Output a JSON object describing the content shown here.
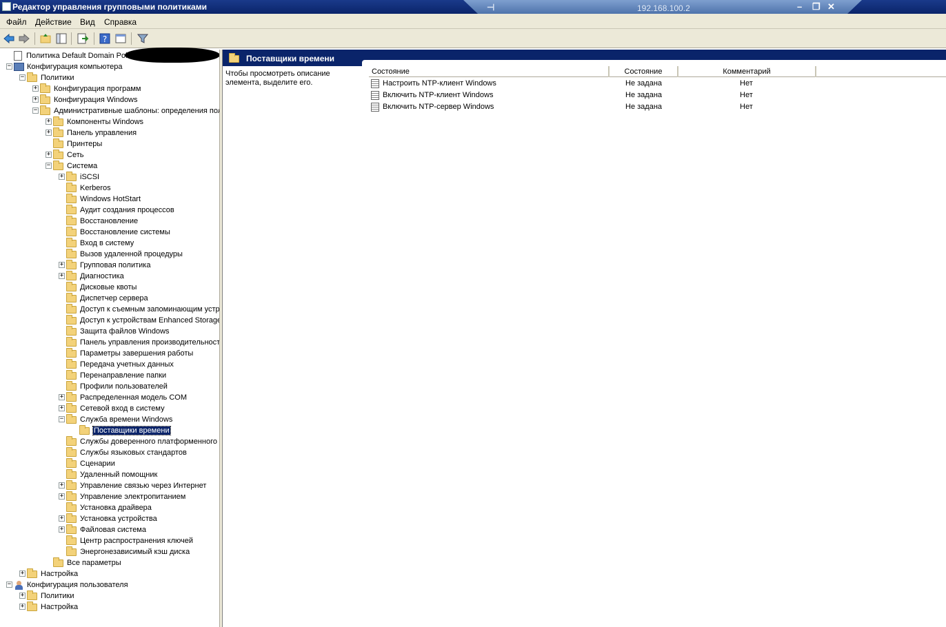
{
  "window": {
    "title": "Редактор управления групповыми политиками"
  },
  "rdp": {
    "ip": "192.168.100.2"
  },
  "menu": [
    "Файл",
    "Действие",
    "Вид",
    "Справка"
  ],
  "tree": [
    {
      "label": "Политика Default Domain Policy [",
      "icon": "document-icon",
      "depth": 0,
      "expander": "none"
    },
    {
      "label": "Конфигурация компьютера",
      "icon": "computer-icon",
      "depth": 0,
      "expander": "minus"
    },
    {
      "label": "Политики",
      "icon": "folder-icon",
      "depth": 1,
      "expander": "minus"
    },
    {
      "label": "Конфигурация программ",
      "icon": "folder-icon",
      "depth": 2,
      "expander": "plus"
    },
    {
      "label": "Конфигурация Windows",
      "icon": "folder-icon",
      "depth": 2,
      "expander": "plus"
    },
    {
      "label": "Административные шаблоны: определения политик",
      "icon": "folder-icon",
      "depth": 2,
      "expander": "minus"
    },
    {
      "label": "Компоненты Windows",
      "icon": "folder-icon",
      "depth": 3,
      "expander": "plus"
    },
    {
      "label": "Панель управления",
      "icon": "folder-icon",
      "depth": 3,
      "expander": "plus"
    },
    {
      "label": "Принтеры",
      "icon": "folder-icon",
      "depth": 3,
      "expander": "none"
    },
    {
      "label": "Сеть",
      "icon": "folder-icon",
      "depth": 3,
      "expander": "plus"
    },
    {
      "label": "Система",
      "icon": "folder-icon",
      "depth": 3,
      "expander": "minus"
    },
    {
      "label": "iSCSI",
      "icon": "folder-icon",
      "depth": 4,
      "expander": "plus"
    },
    {
      "label": "Kerberos",
      "icon": "folder-icon",
      "depth": 4,
      "expander": "none"
    },
    {
      "label": "Windows HotStart",
      "icon": "folder-icon",
      "depth": 4,
      "expander": "none"
    },
    {
      "label": "Аудит создания процессов",
      "icon": "folder-icon",
      "depth": 4,
      "expander": "none"
    },
    {
      "label": "Восстановление",
      "icon": "folder-icon",
      "depth": 4,
      "expander": "none"
    },
    {
      "label": "Восстановление системы",
      "icon": "folder-icon",
      "depth": 4,
      "expander": "none"
    },
    {
      "label": "Вход в систему",
      "icon": "folder-icon",
      "depth": 4,
      "expander": "none"
    },
    {
      "label": "Вызов удаленной процедуры",
      "icon": "folder-icon",
      "depth": 4,
      "expander": "none"
    },
    {
      "label": "Групповая политика",
      "icon": "folder-icon",
      "depth": 4,
      "expander": "plus"
    },
    {
      "label": "Диагностика",
      "icon": "folder-icon",
      "depth": 4,
      "expander": "plus"
    },
    {
      "label": "Дисковые квоты",
      "icon": "folder-icon",
      "depth": 4,
      "expander": "none"
    },
    {
      "label": "Диспетчер сервера",
      "icon": "folder-icon",
      "depth": 4,
      "expander": "none"
    },
    {
      "label": "Доступ к съемным запоминающим устройствам",
      "icon": "folder-icon",
      "depth": 4,
      "expander": "none"
    },
    {
      "label": "Доступ к устройствам Enhanced Storage",
      "icon": "folder-icon",
      "depth": 4,
      "expander": "none"
    },
    {
      "label": "Защита файлов Windows",
      "icon": "folder-icon",
      "depth": 4,
      "expander": "none"
    },
    {
      "label": "Панель управления производительностью",
      "icon": "folder-icon",
      "depth": 4,
      "expander": "none"
    },
    {
      "label": "Параметры завершения работы",
      "icon": "folder-icon",
      "depth": 4,
      "expander": "none"
    },
    {
      "label": "Передача учетных данных",
      "icon": "folder-icon",
      "depth": 4,
      "expander": "none"
    },
    {
      "label": "Перенаправление папки",
      "icon": "folder-icon",
      "depth": 4,
      "expander": "none"
    },
    {
      "label": "Профили пользователей",
      "icon": "folder-icon",
      "depth": 4,
      "expander": "none"
    },
    {
      "label": "Распределенная модель COM",
      "icon": "folder-icon",
      "depth": 4,
      "expander": "plus"
    },
    {
      "label": "Сетевой вход в систему",
      "icon": "folder-icon",
      "depth": 4,
      "expander": "plus"
    },
    {
      "label": "Служба времени Windows",
      "icon": "folder-icon",
      "depth": 4,
      "expander": "minus"
    },
    {
      "label": "Поставщики времени",
      "icon": "folder-icon",
      "depth": 5,
      "expander": "none",
      "selected": true
    },
    {
      "label": "Службы доверенного платформенного модуля",
      "icon": "folder-icon",
      "depth": 4,
      "expander": "none"
    },
    {
      "label": "Службы языковых стандартов",
      "icon": "folder-icon",
      "depth": 4,
      "expander": "none"
    },
    {
      "label": "Сценарии",
      "icon": "folder-icon",
      "depth": 4,
      "expander": "none"
    },
    {
      "label": "Удаленный помощник",
      "icon": "folder-icon",
      "depth": 4,
      "expander": "none"
    },
    {
      "label": "Управление связью через Интернет",
      "icon": "folder-icon",
      "depth": 4,
      "expander": "plus"
    },
    {
      "label": "Управление электропитанием",
      "icon": "folder-icon",
      "depth": 4,
      "expander": "plus"
    },
    {
      "label": "Установка драйвера",
      "icon": "folder-icon",
      "depth": 4,
      "expander": "none"
    },
    {
      "label": "Установка устройства",
      "icon": "folder-icon",
      "depth": 4,
      "expander": "plus"
    },
    {
      "label": "Файловая система",
      "icon": "folder-icon",
      "depth": 4,
      "expander": "plus"
    },
    {
      "label": "Центр распространения ключей",
      "icon": "folder-icon",
      "depth": 4,
      "expander": "none"
    },
    {
      "label": "Энергонезависимый кэш диска",
      "icon": "folder-icon",
      "depth": 4,
      "expander": "none"
    },
    {
      "label": "Все параметры",
      "icon": "folder-icon",
      "depth": 3,
      "expander": "none"
    },
    {
      "label": "Настройка",
      "icon": "folder-icon",
      "depth": 1,
      "expander": "plus"
    },
    {
      "label": "Конфигурация пользователя",
      "icon": "user-icon",
      "depth": 0,
      "expander": "minus"
    },
    {
      "label": "Политики",
      "icon": "folder-icon",
      "depth": 1,
      "expander": "plus"
    },
    {
      "label": "Настройка",
      "icon": "folder-icon",
      "depth": 1,
      "expander": "plus"
    }
  ],
  "content": {
    "title": "Поставщики времени",
    "description": "Чтобы просмотреть описание элемента, выделите его.",
    "columns": [
      "Состояние",
      "Состояние",
      "Комментарий"
    ],
    "rows": [
      {
        "name": "Настроить NTP-клиент Windows",
        "state": "Не задана",
        "comment": "Нет"
      },
      {
        "name": "Включить NTP-клиент Windows",
        "state": "Не задана",
        "comment": "Нет"
      },
      {
        "name": "Включить NTP-сервер Windows",
        "state": "Не задана",
        "comment": "Нет"
      }
    ]
  }
}
